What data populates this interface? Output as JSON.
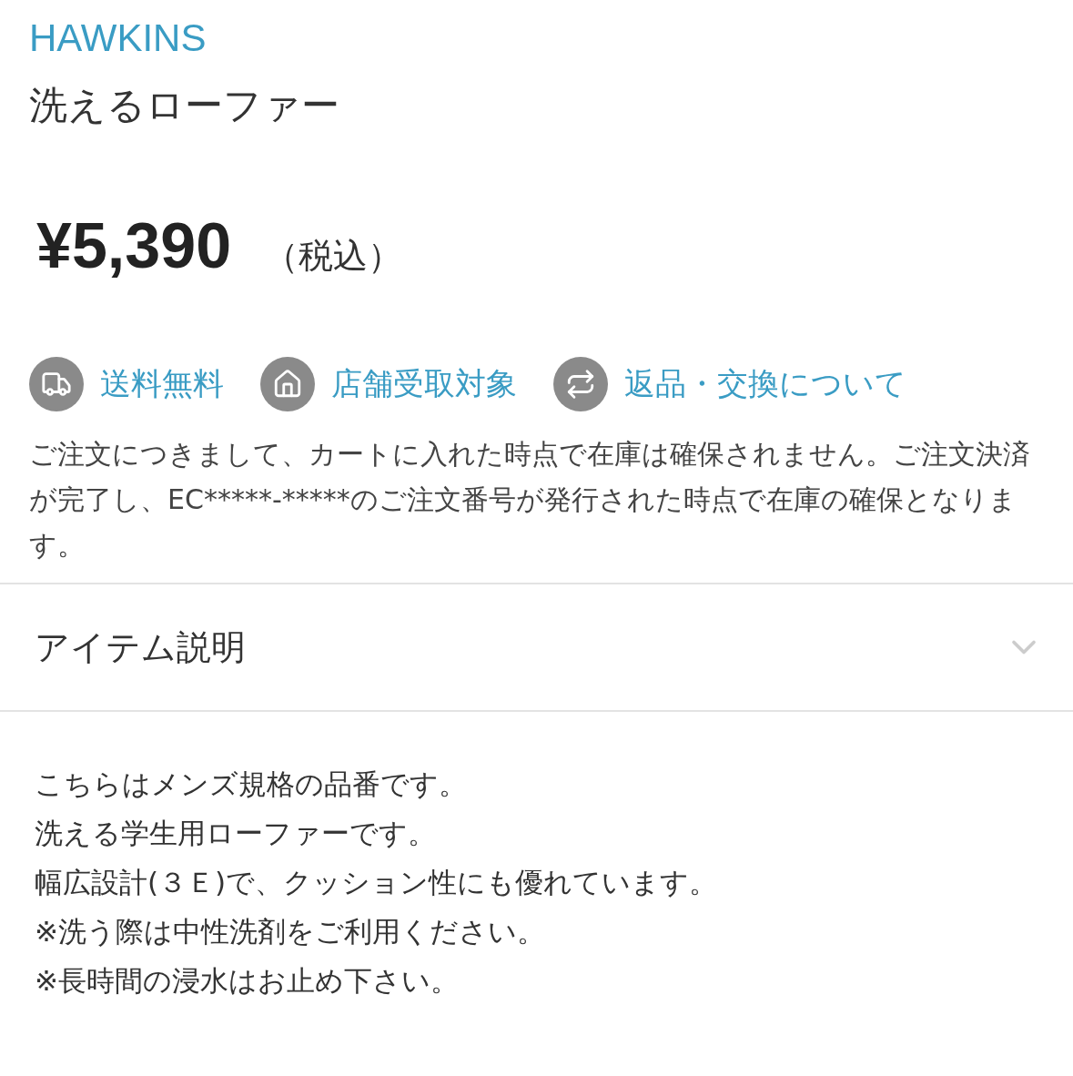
{
  "brand": "HAWKINS",
  "title": "洗えるローファー",
  "price": {
    "amount": "¥5,390",
    "tax_note": "（税込）"
  },
  "features": [
    {
      "kind": "shipping",
      "label": "送料無料"
    },
    {
      "kind": "store",
      "label": "店舗受取対象"
    },
    {
      "kind": "exchange",
      "label": "返品・交換について"
    }
  ],
  "notice": "ご注文につきまして、カートに入れた時点で在庫は確保されません。ご注文決済が完了し、EC*****-*****のご注文番号が発行された時点で在庫の確保となります。",
  "accordion": {
    "title": "アイテム説明",
    "expanded": true,
    "lines": [
      "こちらはメンズ規格の品番です。",
      "洗える学生用ローファーです。",
      "幅広設計(３Ｅ)で、クッション性にも優れています。",
      "※洗う際は中性洗剤をご利用ください。",
      "※長時間の浸水はお止め下さい。"
    ]
  }
}
